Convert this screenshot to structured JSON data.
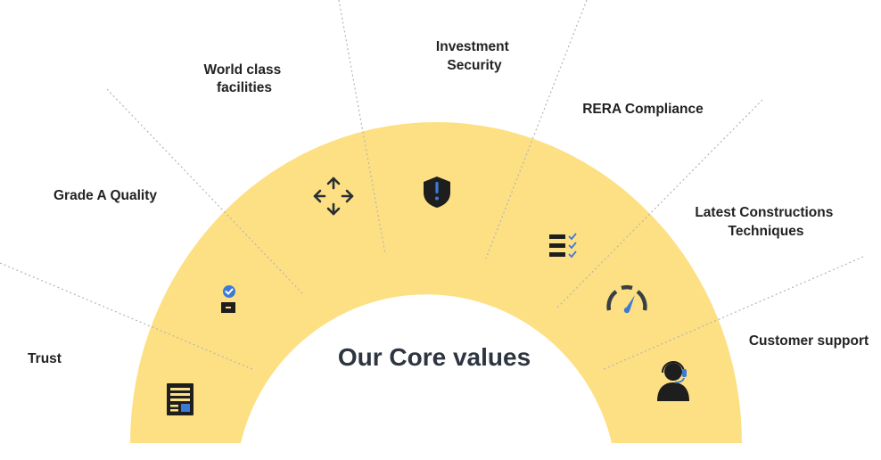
{
  "diagram": {
    "title": "Our Core values",
    "colors": {
      "band": "#fde084",
      "text": "#222222",
      "title": "#2d3540",
      "guide": "#b5b5b5",
      "icon_dark": "#1e1e1e",
      "icon_accent": "#3d7ad6"
    },
    "values": [
      {
        "id": "trust",
        "lines": [
          "Trust"
        ],
        "icon": "document-icon"
      },
      {
        "id": "grade-a-quality",
        "lines": [
          "Grade A Quality"
        ],
        "icon": "verified-box-icon"
      },
      {
        "id": "world-class-facilities",
        "lines": [
          "World class",
          "facilities"
        ],
        "icon": "move-arrows-icon"
      },
      {
        "id": "investment-security",
        "lines": [
          "Investment",
          "Security"
        ],
        "icon": "shield-alert-icon"
      },
      {
        "id": "rera-compliance",
        "lines": [
          "RERA Compliance"
        ],
        "icon": "checklist-icon"
      },
      {
        "id": "latest-construction-techniques",
        "lines": [
          "Latest Constructions",
          "Techniques"
        ],
        "icon": "speedometer-icon"
      },
      {
        "id": "customer-support",
        "lines": [
          "Customer support"
        ],
        "icon": "headset-user-icon"
      }
    ]
  }
}
